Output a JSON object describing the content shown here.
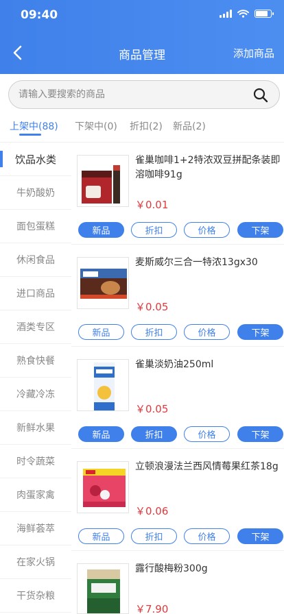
{
  "status_bar": {
    "time": "09:40"
  },
  "nav": {
    "title": "商品管理",
    "add_label": "添加商品"
  },
  "search": {
    "placeholder": "请输入要搜索的商品"
  },
  "tabs": [
    {
      "label": "上架中(88)"
    },
    {
      "label": "下架中(0)"
    },
    {
      "label": "折扣(2)"
    },
    {
      "label": "新品(2)"
    }
  ],
  "sidebar": {
    "items": [
      {
        "label": "饮品水类"
      },
      {
        "label": "牛奶酸奶"
      },
      {
        "label": "面包蛋糕"
      },
      {
        "label": "休闲食品"
      },
      {
        "label": "进口商品"
      },
      {
        "label": "酒类专区"
      },
      {
        "label": "熟食快餐"
      },
      {
        "label": "冷藏冷冻"
      },
      {
        "label": "新鲜水果"
      },
      {
        "label": "时令蔬菜"
      },
      {
        "label": "肉蛋家禽"
      },
      {
        "label": "海鲜荟萃"
      },
      {
        "label": "在家火锅"
      },
      {
        "label": "干货杂粮"
      }
    ]
  },
  "products": [
    {
      "name": "雀巢咖啡1+2特浓双豆拼配条装即溶咖啡91g",
      "price": "￥0.01",
      "image": "coffee-box"
    },
    {
      "name": "麦斯威尔三合一特浓13gx30",
      "price": "￥0.05",
      "image": "maxwell-box"
    },
    {
      "name": "雀巢淡奶油250ml",
      "price": "￥0.05",
      "image": "cream-carton"
    },
    {
      "name": "立顿浪漫法兰西风情莓果红茶18g",
      "price": "￥0.06",
      "image": "lipton-box"
    },
    {
      "name": "露行酸梅粉300g",
      "price": "￥7.90",
      "image": "plum-powder-bag"
    }
  ],
  "actions": {
    "new_label": "新品",
    "discount_label": "折扣",
    "price_label": "价格",
    "offshelf_label": "下架"
  },
  "colors": {
    "accent": "#3f80ea",
    "price": "#e4393c"
  }
}
